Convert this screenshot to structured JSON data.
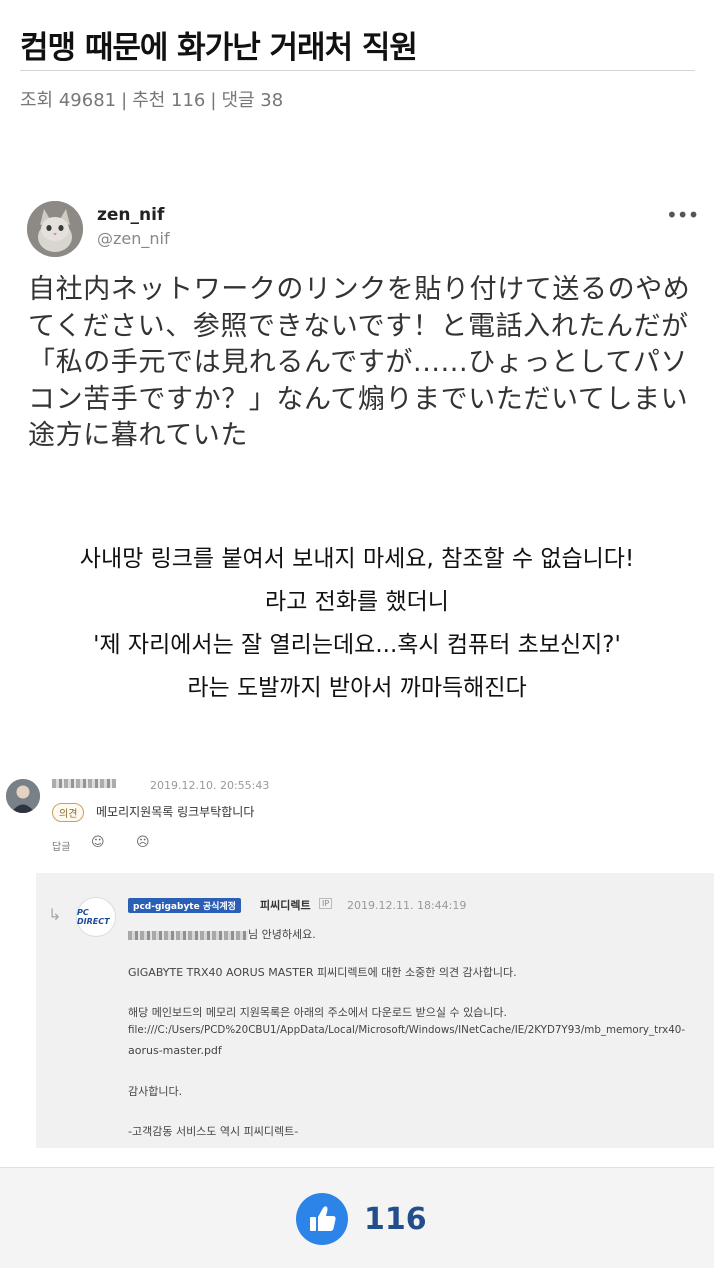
{
  "post": {
    "title": "컴맹 때문에 화가난 거래처 직원",
    "views": "조회 49681",
    "recommends": "추천 116",
    "comments": "댓글 38",
    "separator": "|"
  },
  "tweet": {
    "name": "zen_nif",
    "handle": "@zen_nif",
    "more": "•••",
    "text": "自社内ネットワークのリンクを貼り付けて送るのやめてください、参照できないです！と電話入れたんだが「私の手元では見れるんですが......ひょっとしてパソコン苦手ですか？」なんて煽りまでいただいてしまい途方に暮れていた"
  },
  "translation": [
    "사내망 링크를 붙여서 보내지 마세요, 참조할 수 없습니다!",
    "라고 전화를 했더니",
    "'제 자리에서는 잘 열리는데요...혹시 컴퓨터 초보신지?'",
    "라는 도발까지 받아서 까마득해진다"
  ],
  "comment": {
    "date": "2019.12.10. 20:55:43",
    "badge": "의견",
    "text": "메모리지원목록 링크부탁합니다",
    "reply_label": "답글",
    "like_emoji": "☺",
    "dislike_emoji": "☹"
  },
  "reply": {
    "arrow": "↳",
    "logo": "PC DIRECT",
    "tag": "pcd-gigabyte 공식계정",
    "name": "피씨디렉트",
    "ip": "IP",
    "date": "2019.12.11. 18:44:19",
    "greeting_suffix": "님 안녕하세요.",
    "line1": "GIGABYTE TRX40 AORUS MASTER 피씨디렉트에 대한 소중한 의견 감사합니다.",
    "line2": "해당 메인보드의 메모리 지원목록은 아래의 주소에서 다운로드 받으실 수 있습니다.",
    "line3": "file:///C:/Users/PCD%20CBU1/AppData/Local/Microsoft/Windows/INetCache/IE/2KYD7Y93/mb_memory_trx40-",
    "line4": "aorus-master.pdf",
    "line5": "감사합니다.",
    "line6": "-고객감동 서비스도 역시 피씨디렉트-"
  },
  "like": {
    "count": "116",
    "color": "#2c84e8"
  }
}
